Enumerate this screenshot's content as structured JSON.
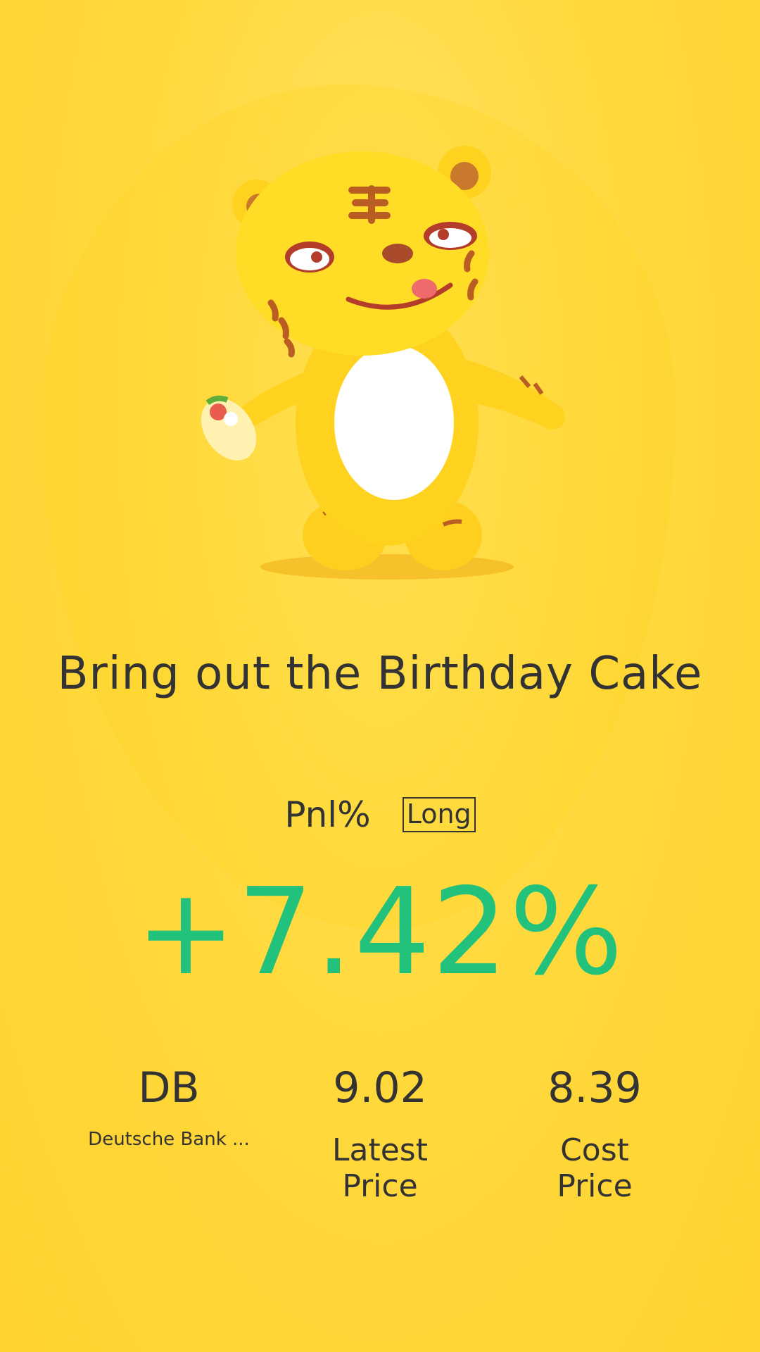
{
  "headline": "Bring out the Birthday Cake",
  "pnl": {
    "label": "Pnl%",
    "position_tag": "Long",
    "value": "+7.42%"
  },
  "stats": {
    "ticker": {
      "value": "DB",
      "name": "Deutsche Bank ..."
    },
    "latest_price": {
      "value": "9.02",
      "label_line1": "Latest",
      "label_line2": "Price"
    },
    "cost_price": {
      "value": "8.39",
      "label_line1": "Cost",
      "label_line2": "Price"
    }
  },
  "colors": {
    "background": "#ffd93e",
    "pnl_positive": "#23c27c",
    "text": "#333333"
  },
  "icons": {
    "mascot": "tiger-mascot-holding-food"
  }
}
